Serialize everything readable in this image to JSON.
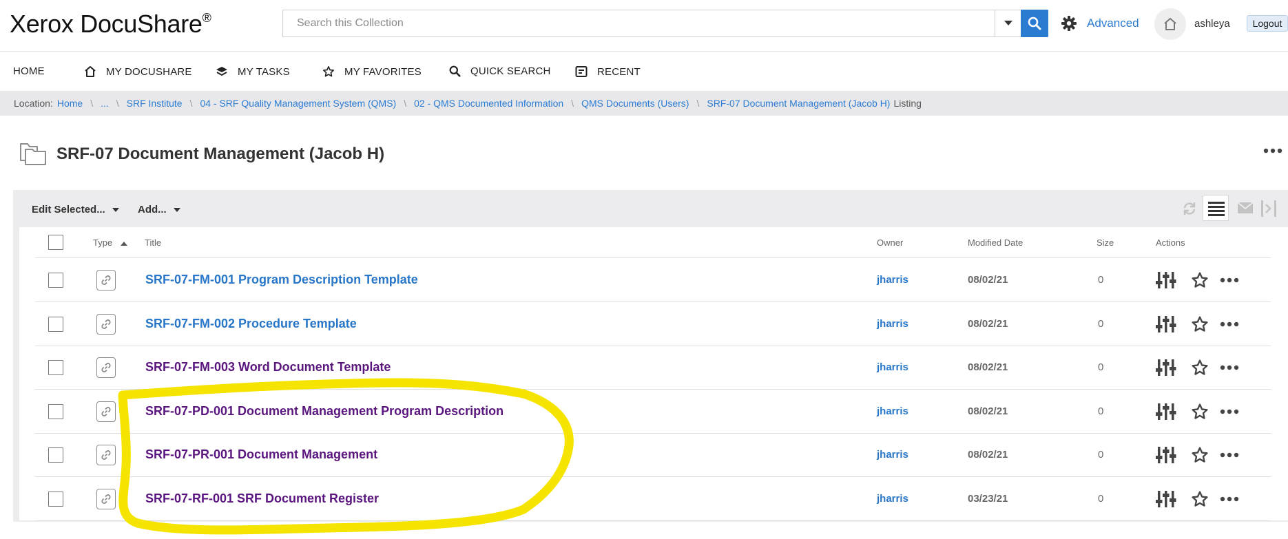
{
  "app": {
    "logo_text": "Xerox DocuShare",
    "logo_mark": "®"
  },
  "search": {
    "placeholder": "Search this Collection",
    "advanced_label": "Advanced"
  },
  "user": {
    "name": "ashleya",
    "logout_label": "Logout"
  },
  "nav": {
    "home": "HOME",
    "my_docushare": "MY DOCUSHARE",
    "my_tasks": "MY TASKS",
    "my_favorites": "MY FAVORITES",
    "quick_search": "QUICK SEARCH",
    "recent": "RECENT"
  },
  "breadcrumb": {
    "location_label": "Location:",
    "items": [
      "Home",
      "...",
      "SRF Institute",
      "04 - SRF Quality Management System (QMS)",
      "02 - QMS Documented Information",
      "QMS Documents (Users)",
      "SRF-07 Document Management (Jacob H)"
    ],
    "suffix": "Listing"
  },
  "page": {
    "title": "SRF-07 Document Management (Jacob H)"
  },
  "toolbar": {
    "edit_selected": "Edit Selected...",
    "add": "Add..."
  },
  "columns": {
    "type": "Type",
    "title": "Title",
    "owner": "Owner",
    "modified": "Modified Date",
    "size": "Size",
    "actions": "Actions"
  },
  "rows": [
    {
      "title": "SRF-07-FM-001 Program Description Template",
      "owner": "jharris",
      "modified": "08/02/21",
      "size": "0",
      "visited": false
    },
    {
      "title": "SRF-07-FM-002 Procedure Template",
      "owner": "jharris",
      "modified": "08/02/21",
      "size": "0",
      "visited": false
    },
    {
      "title": "SRF-07-FM-003 Word Document Template",
      "owner": "jharris",
      "modified": "08/02/21",
      "size": "0",
      "visited": true
    },
    {
      "title": "SRF-07-PD-001 Document Management Program Description",
      "owner": "jharris",
      "modified": "08/02/21",
      "size": "0",
      "visited": true
    },
    {
      "title": "SRF-07-PR-001 Document Management",
      "owner": "jharris",
      "modified": "08/02/21",
      "size": "0",
      "visited": true
    },
    {
      "title": "SRF-07-RF-001 SRF Document Register",
      "owner": "jharris",
      "modified": "03/23/21",
      "size": "0",
      "visited": true
    }
  ],
  "colors": {
    "accent": "#2b7bd3",
    "link": "#2876c8",
    "visited": "#5a167e",
    "highlight": "#f5e400"
  }
}
